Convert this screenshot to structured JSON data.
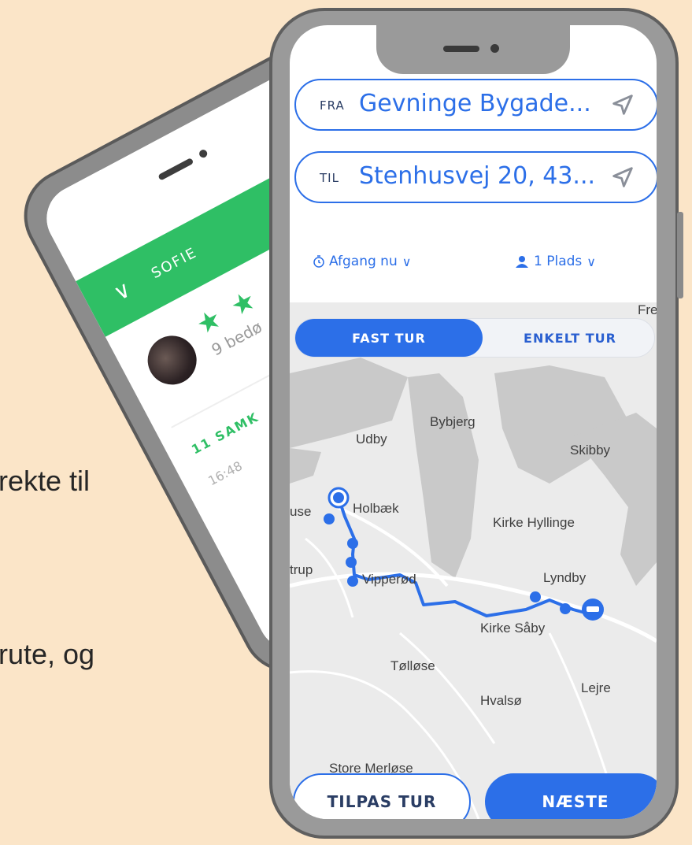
{
  "background": {
    "line1": "rekte til",
    "line2": "rute, og"
  },
  "back_phone": {
    "name": "SOFIE",
    "stars": "★ ★",
    "rating_text": "9 bedø",
    "trips_text": "11 SAMK",
    "time_text": "16:48"
  },
  "from": {
    "prefix": "FRA",
    "value": "Gevninge Bygade..."
  },
  "to": {
    "prefix": "TIL",
    "value": "Stenhusvej 20, 43..."
  },
  "options": {
    "departure": "Afgang nu",
    "seats": "1 Plads"
  },
  "trip_type": {
    "active": "FAST TUR",
    "inactive": "ENKELT TUR"
  },
  "map_labels": {
    "fre": "Fre",
    "bybjerg": "Bybjerg",
    "udby": "Udby",
    "skibby": "Skibby",
    "use": "use",
    "holbaek": "Holbæk",
    "kirke_hyllinge": "Kirke Hyllinge",
    "trup": "trup",
    "vipperod": "Vipperød",
    "lyndby": "Lyndby",
    "kirke_saby": "Kirke Såby",
    "tollose": "Tølløse",
    "lejre": "Lejre",
    "hvalso": "Hvalsø",
    "store_merlose": "Store Merløse"
  },
  "actions": {
    "customize": "TILPAS TUR",
    "next": "NÆSTE"
  },
  "colors": {
    "accent": "#2c6fe8",
    "green": "#2fbf65",
    "background": "#fbe5c8"
  }
}
